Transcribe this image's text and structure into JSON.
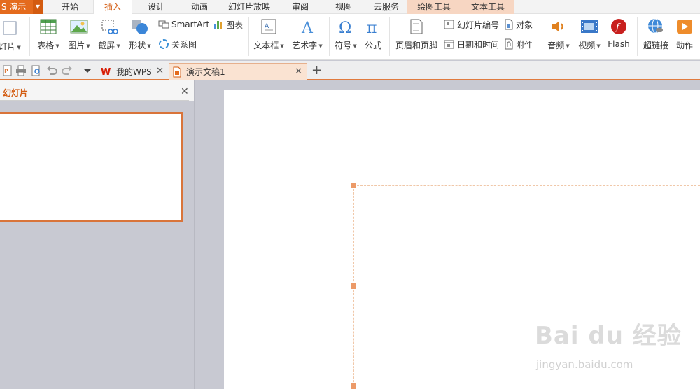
{
  "app": {
    "name": "S 演示"
  },
  "menu": {
    "tabs": [
      {
        "label": "开始"
      },
      {
        "label": "插入"
      },
      {
        "label": "设计"
      },
      {
        "label": "动画"
      },
      {
        "label": "幻灯片放映"
      },
      {
        "label": "审阅"
      },
      {
        "label": "视图"
      },
      {
        "label": "云服务"
      },
      {
        "label": "绘图工具"
      },
      {
        "label": "文本工具"
      }
    ],
    "active_tab": "插入"
  },
  "ribbon": {
    "new_slide": "灯片",
    "table": "表格",
    "picture": "图片",
    "screenshot": "截屏",
    "shapes": "形状",
    "smartart": "SmartArt",
    "chart": "图表",
    "relation": "关系图",
    "textbox": "文本框",
    "wordart": "艺术字",
    "symbol": "符号",
    "formula": "公式",
    "header_footer": "页眉和页脚",
    "slide_number": "幻灯片编号",
    "object": "对象",
    "date_time": "日期和时间",
    "attachment": "附件",
    "audio": "音频",
    "video": "视频",
    "flash": "Flash",
    "hyperlink": "超链接",
    "action": "动作"
  },
  "doc_tabs": [
    {
      "label": "我的WPS"
    },
    {
      "label": "演示文稿1"
    }
  ],
  "left_pane": {
    "title": "幻灯片"
  },
  "watermark": {
    "brand": "Bai du 经验",
    "url": "jingyan.baidu.com"
  },
  "colors": {
    "accent": "#e46b1d",
    "context_tab": "#f7d6c2",
    "selection_handle": "#ec9a68"
  }
}
